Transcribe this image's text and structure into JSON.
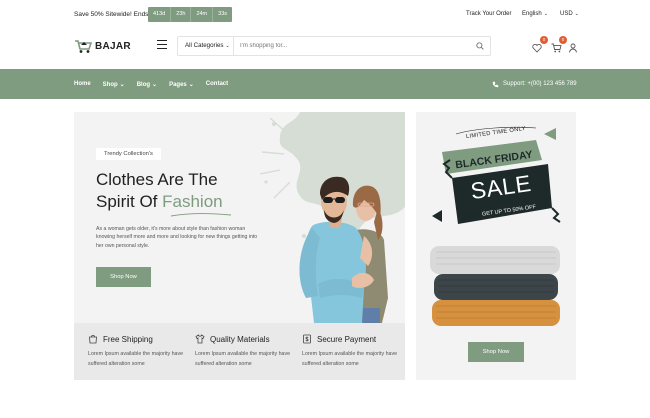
{
  "topbar": {
    "promo": "Save 50% Sitewide! Ends in:",
    "countdown": [
      "413d",
      "23h",
      "24m",
      "33s"
    ],
    "track": "Track Your Order",
    "language": "English",
    "currency": "USD"
  },
  "header": {
    "logo": "BAJAR",
    "category": "All Categories",
    "search_placeholder": "I'm shopping for...",
    "wishlist_count": "0",
    "cart_count": "0"
  },
  "nav": {
    "links": [
      "Home",
      "Shop",
      "Blog",
      "Pages",
      "Contact"
    ],
    "support": "Support: +(00) 123 456 789"
  },
  "hero": {
    "tag": "Trendy Collection's",
    "headline_line1": "Clothes Are The",
    "headline_line2": "Spirit Of",
    "headline_accent": "Fashion",
    "description": "As a woman gets older, it's more about style than fashion woman knowing herself more and more and looking for new things getting into her own personal style.",
    "button": "Shop Now"
  },
  "features": [
    {
      "title": "Free Shipping",
      "text": "Lorem Ipsum available the majority have suffered alteration some"
    },
    {
      "title": "Quality Materials",
      "text": "Lorem Ipsum available the majority have suffered alteration some"
    },
    {
      "title": "Secure Payment",
      "text": "Lorem Ipsum available the majority have suffered alteration some"
    }
  ],
  "promo": {
    "limited": "LIMITED TIME ONLY",
    "black_friday": "BLACK FRIDAY",
    "sale": "SALE",
    "upto": "GET UP TO 50% OFF",
    "button": "Shop Now"
  },
  "colors": {
    "accent": "#7f9b80",
    "badge": "#e25d33",
    "dark": "#1e2a2a"
  }
}
